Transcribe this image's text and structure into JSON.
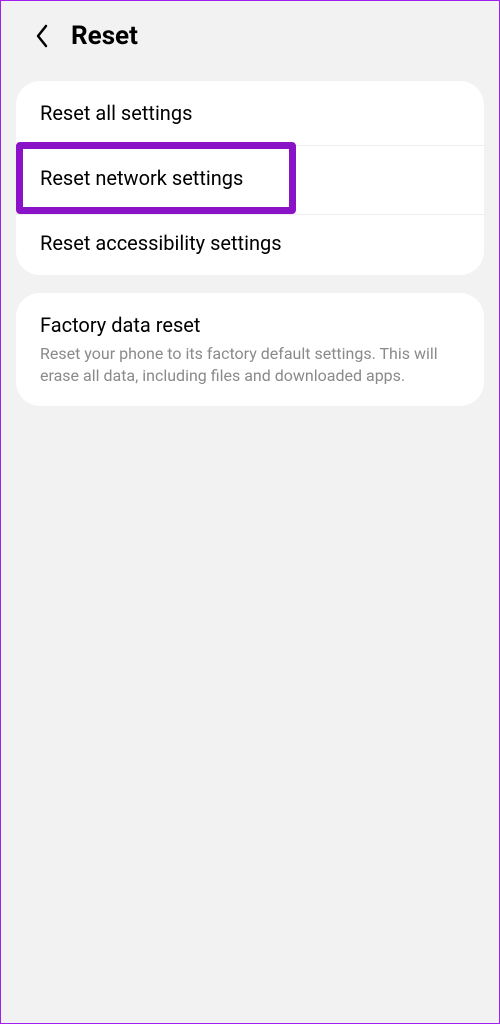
{
  "header": {
    "title": "Reset"
  },
  "group1": {
    "items": [
      {
        "label": "Reset all settings"
      },
      {
        "label": "Reset network settings"
      },
      {
        "label": "Reset accessibility settings"
      }
    ]
  },
  "group2": {
    "title": "Factory data reset",
    "description": "Reset your phone to its factory default settings. This will erase all data, including files and downloaded apps."
  },
  "colors": {
    "highlight": "#8a13c8"
  }
}
